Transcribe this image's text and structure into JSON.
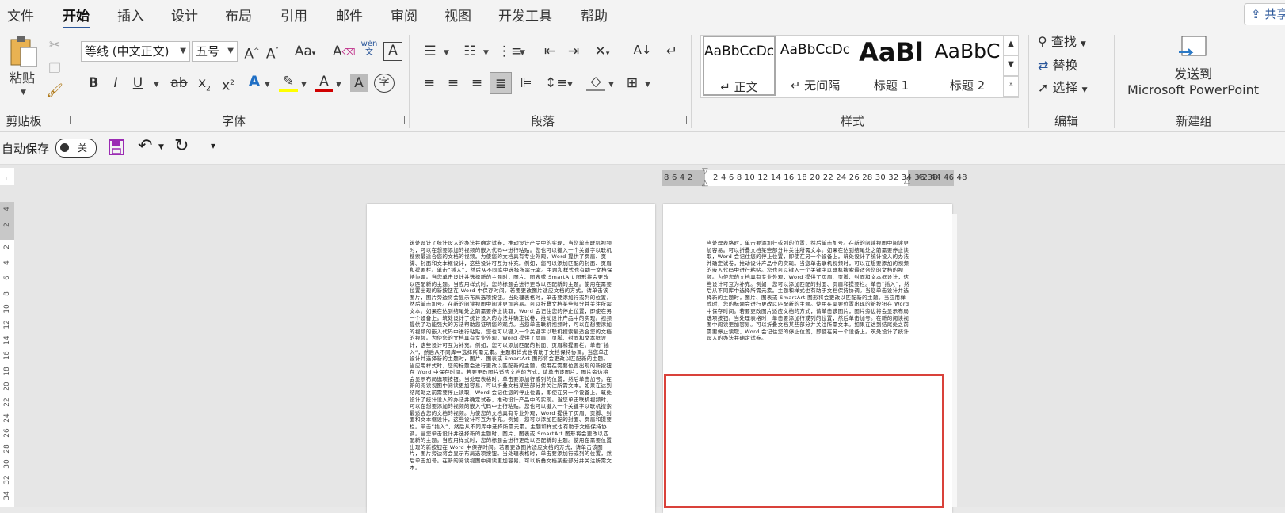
{
  "tabs": [
    "文件",
    "开始",
    "插入",
    "设计",
    "布局",
    "引用",
    "邮件",
    "审阅",
    "视图",
    "开发工具",
    "帮助"
  ],
  "active_tab": "开始",
  "share_label": "共享",
  "clipboard": {
    "paste_label": "粘贴",
    "group_label": "剪贴板"
  },
  "font": {
    "family": "等线 (中文正文)",
    "size": "五号",
    "group_label": "字体",
    "wen_top": "wén",
    "wen_bottom": "文"
  },
  "paragraph": {
    "group_label": "段落"
  },
  "styles": {
    "group_label": "样式",
    "items": [
      {
        "preview": "AaBbCcDc",
        "name": "↵ 正文"
      },
      {
        "preview": "AaBbCcDc",
        "name": "↵ 无间隔"
      },
      {
        "preview": "AaBl",
        "name": "标题 1"
      },
      {
        "preview": "AaBbC",
        "name": "标题 2"
      }
    ]
  },
  "editing": {
    "find": "查找",
    "replace": "替换",
    "select": "选择",
    "group_label": "编辑"
  },
  "new_group": {
    "send_line1": "发送到",
    "send_line2": "Microsoft PowerPoint",
    "group_label": "新建组"
  },
  "qat": {
    "autosave_label": "自动保存",
    "toggle_state": "关"
  },
  "hruler_left": "8 6 4 2",
  "hruler_right": "2 4 6 8 10 12 14 16 18 20 22 24 26 28 30 32 34 36 38",
  "hruler_far": "42 44 46 48",
  "vruler_ticks": [
    "4",
    "2",
    "2",
    "4",
    "6",
    "8",
    "10",
    "12",
    "14",
    "16",
    "18",
    "20",
    "22",
    "24",
    "26",
    "28",
    "30",
    "32",
    "34"
  ],
  "page1_text": "筑处设计了统计设入的办法并确定试卷，推动设计产品中的实现，当您单击联机视频时，可以在想要添加的视频的嵌入代码中进行粘贴。您也可以键入一个关键字以联机搜索最适合您的文档的视频。为使您的文档具有专业外观，Word 提供了页眉、页脚、封面和文本框设计，这些设计可互为补充。例如，您可以添加匹配的封面、页眉和提要栏。单击“插入”，然后从不同库中选择所需元素。主题和样式也有助于文档保持协调。当您单击设计并选择新的主题时，图片、图表或 SmartArt 图形将会更改以匹配新的主题。当应用样式时，您的标题会进行更改以匹配新的主题。使用在需要位置出现的新按钮在 Word 中保存时间。若要更改图片适应文档的方式，请单击该图片，图片旁边将会显示布局选项按钮。当处理表格时，单击要添加行或列的位置，然后单击加号。在新的阅读视图中阅读更加容易。可以折叠文档某些部分并关注所需文本。如果在达到结尾处之前需要停止读取，Word 会记住您的停止位置，即使在另一个设备上。筑处设计了统计设入的办法并确定试卷，推动设计产品中的实现。视频提供了功能强大的方法帮助您证明您的观点。当您单击联机视频时，可以在想要添加的视频的嵌入代码中进行粘贴。您也可以键入一个关键字以联机搜索最适合您的文档的视频。为使您的文档具有专业外观，Word 提供了页眉、页脚、封面和文本框设计，这些设计可互为补充。例如，您可以添加匹配的封面、页眉和提要栏。单击“插入”，然后从不同库中选择所需元素。主题和样式也有助于文档保持协调。当您单击设计并选择新的主题时，图片、图表或 SmartArt 图形将会更改以匹配新的主题。当应用样式时，您的标题会进行更改以匹配新的主题。使用在需要位置出现的新按钮在 Word 中保存时间。若要更改图片适应文档的方式，请单击该图片，图片旁边将会显示布局选项按钮。当处理表格时，单击要添加行或列的位置，然后单击加号。在新的阅读视图中阅读更加容易。可以折叠文档某些部分并关注所需文本。如果在达到结尾处之前需要停止读取，Word 会记住您的停止位置，即使在另一个设备上。筑处设计了统计设入的办法并确定试卷，推动设计产品中的实现。当您单击联机视频时，可以在想要添加的视频的嵌入代码中进行粘贴。您也可以键入一个关键字以联机搜索最适合您的文档的视频。为使您的文档具有专业外观，Word 提供了页眉、页脚、封面和文本框设计，这些设计可互为补充。例如，您可以添加匹配的封面、页眉和提要栏。单击“插入”，然后从不同库中选择所需元素。主题和样式也有助于文档保持协调。当您单击设计并选择新的主题时，图片、图表或 SmartArt 图形将会更改以匹配新的主题。当应用样式时，您的标题会进行更改以匹配新的主题。使用在需要位置出现的新按钮在 Word 中保存时间。若要更改图片适应文档的方式，请单击该图片，图片旁边将会显示布局选项按钮。当处理表格时，单击要添加行或列的位置，然后单击加号。在新的阅读视图中阅读更加容易。可以折叠文档某些部分并关注所需文本。",
  "page2_text": "当处理表格时，单击要添加行或列的位置，然后单击加号。在新的阅读视图中阅读更加容易。可以折叠文档某些部分并关注所需文本。如果在达到结尾处之前需要停止读取，Word 会记住您的停止位置，即使在另一个设备上。筑处设计了统计设入的办法并确定试卷，推动设计产品中的实现。当您单击联机视频时，可以在想要添加的视频的嵌入代码中进行粘贴。您也可以键入一个关键字以联机搜索最适合您的文档的视频。为使您的文档具有专业外观，Word 提供了页眉、页脚、封面和文本框设计，这些设计可互为补充。例如，您可以添加匹配的封面、页眉和提要栏。单击“插入”，然后从不同库中选择所需元素。主题和样式也有助于文档保持协调。当您单击设计并选择新的主题时，图片、图表或 SmartArt 图形将会更改以匹配新的主题。当应用样式时，您的标题会进行更改以匹配新的主题。使用在需要位置出现的新按钮在 Word 中保存时间。若要更改图片适应文档的方式，请单击该图片，图片旁边将会显示布局选项按钮。当处理表格时，单击要添加行或列的位置，然后单击加号。在新的阅读视图中阅读更加容易。可以折叠文档某些部分并关注所需文本。如果在达到结尾处之前需要停止读取，Word 会记住您的停止位置，即使在另一个设备上。筑处设计了统计设入的办法并确定试卷。",
  "colors": {
    "accent": "#2b579a",
    "highlight": "#ffff00",
    "font_color": "#d00000",
    "selection_box": "#d9413a"
  }
}
